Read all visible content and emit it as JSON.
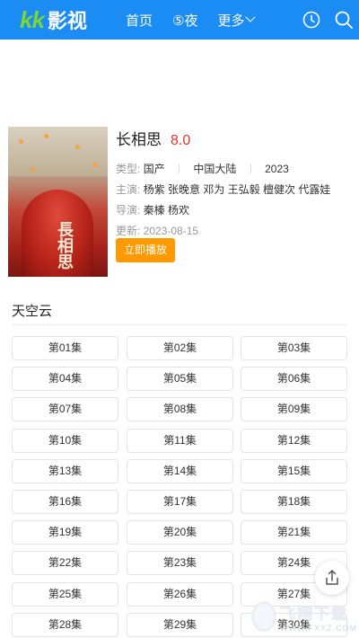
{
  "header": {
    "logo_kk": "kk",
    "logo_text": "影视",
    "nav": [
      "首页",
      "⑤夜",
      "更多"
    ],
    "bg_color": "#1b8cf3"
  },
  "detail": {
    "title": "长相思",
    "score": "8.0",
    "type_label": "类型:",
    "type_value": "国产",
    "region": "中国大陆",
    "year": "2023",
    "cast_label": "主演:",
    "cast_value": "杨紫 张晚意 邓为 王弘毅 檀健次 代露娃",
    "director_label": "导演:",
    "director_value": "秦榛 杨欢",
    "updated_label": "更新:",
    "updated_value": "2023-08-15",
    "play_label": "立即播放",
    "poster_art_text": "長相思"
  },
  "source": {
    "name": "天空云",
    "episodes": [
      "第01集",
      "第02集",
      "第03集",
      "第04集",
      "第05集",
      "第06集",
      "第07集",
      "第08集",
      "第09集",
      "第10集",
      "第11集",
      "第12集",
      "第13集",
      "第14集",
      "第15集",
      "第16集",
      "第17集",
      "第18集",
      "第19集",
      "第20集",
      "第21集",
      "第22集",
      "第23集",
      "第24集",
      "第25集",
      "第26集",
      "第27集",
      "第28集",
      "第29集",
      "第30集"
    ]
  },
  "watermark": {
    "main": "飞翔下载",
    "sub": "WWW.FXXZ.COM"
  },
  "icons": {
    "clock": "clock-icon",
    "search": "search-icon",
    "share": "share-icon"
  }
}
